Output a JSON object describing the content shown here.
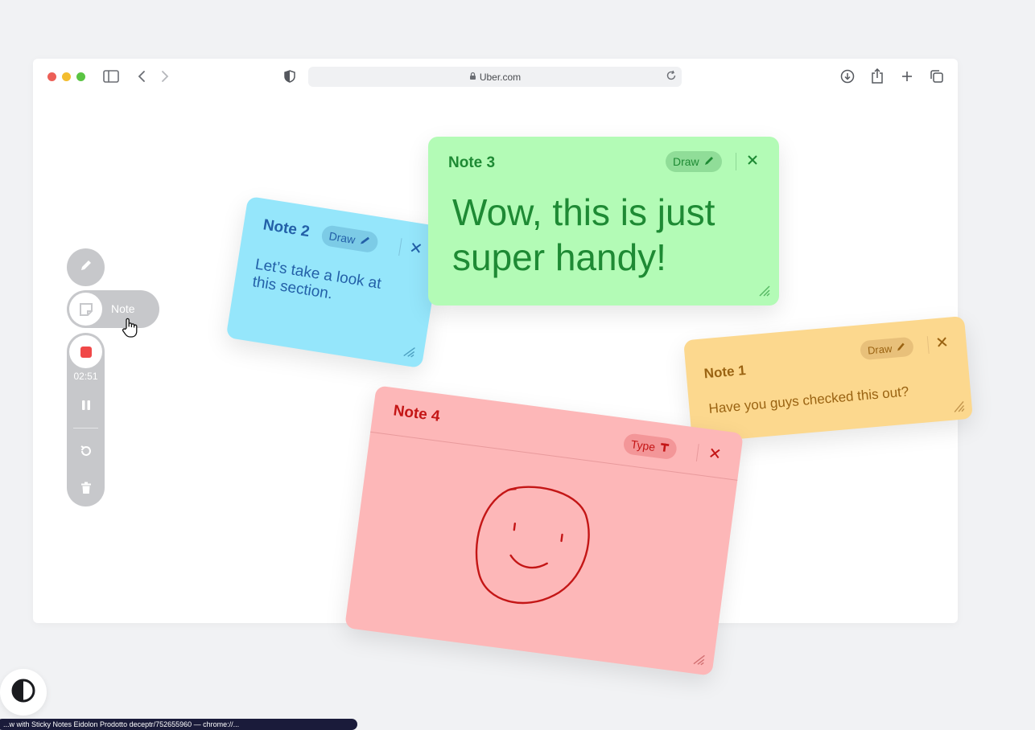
{
  "browser": {
    "url": "Uber.com",
    "icons": [
      "sidebar-icon",
      "back-icon",
      "forward-icon",
      "shield-icon",
      "lock-icon",
      "reload-icon",
      "download-icon",
      "share-icon",
      "new-tab-icon",
      "tabs-overview-icon"
    ]
  },
  "dock": {
    "note_label": "Note",
    "timer": "02:51"
  },
  "notes": [
    {
      "id": "note1",
      "title": "Note 1",
      "mode": "Draw",
      "text": "Have you guys checked this out?",
      "color": "#fcd88e",
      "accent": "#9a6312"
    },
    {
      "id": "note2",
      "title": "Note 2",
      "mode": "Draw",
      "text": "Let’s take a look at this section.",
      "color": "#95e6fb",
      "accent": "#2360a8"
    },
    {
      "id": "note3",
      "title": "Note 3",
      "mode": "Draw",
      "text": "Wow, this is just super handy!",
      "color": "#b3fbb6",
      "accent": "#1e8a34"
    },
    {
      "id": "note4",
      "title": "Note 4",
      "mode": "Type",
      "text": "",
      "color": "#fdb7b8",
      "accent": "#c41616"
    }
  ],
  "bottom_bar": {
    "text": "...w with Sticky Notes Eidolon Prodotto deceptr/752655960 — chrome://..."
  }
}
